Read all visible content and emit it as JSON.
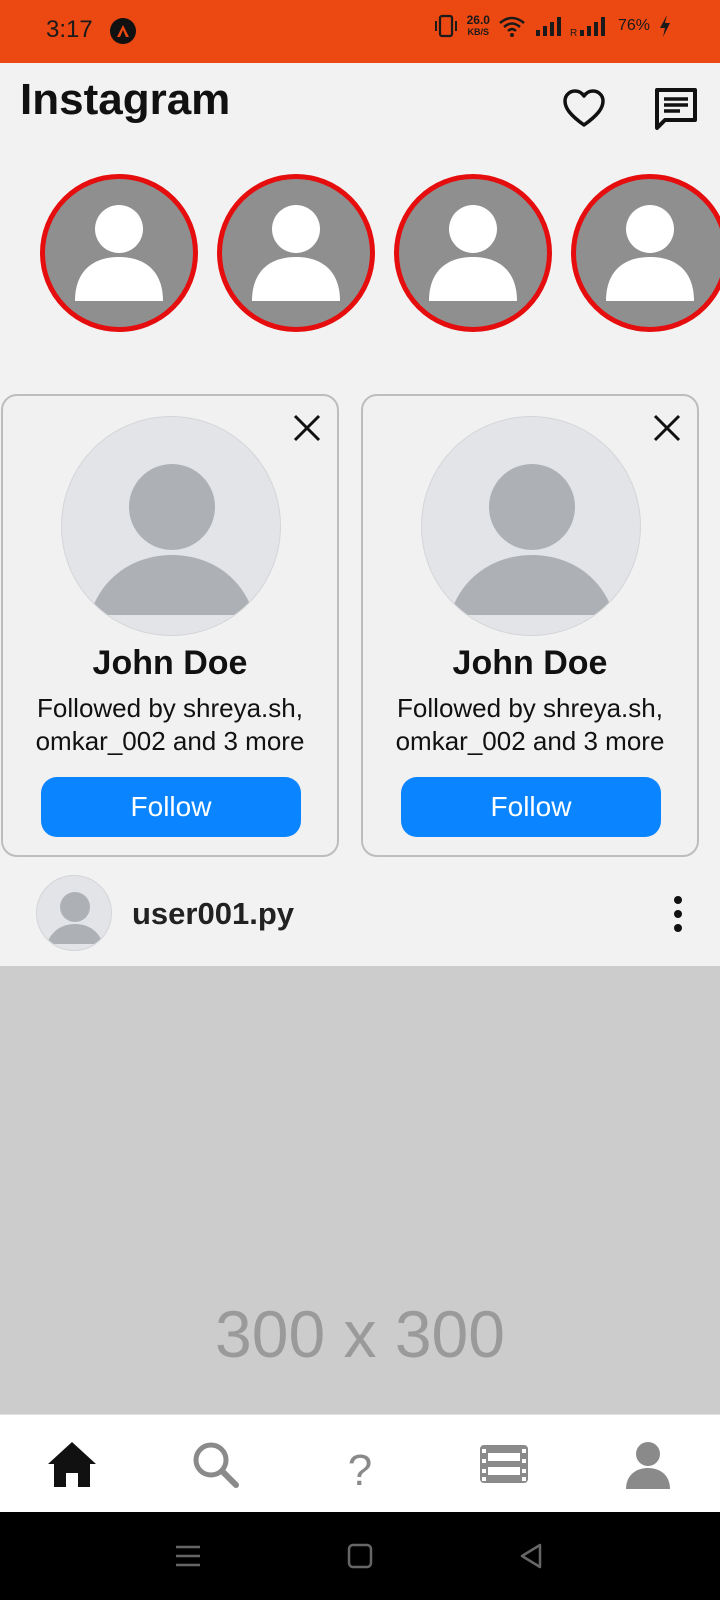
{
  "status_bar": {
    "time": "3:17",
    "speed_value": "26.0",
    "speed_unit": "KB/S",
    "battery": "76%"
  },
  "header": {
    "title": "Instagram"
  },
  "stories": {
    "count_visible": 4,
    "ring_color": "#e50d0d"
  },
  "suggestions": [
    {
      "name": "John Doe",
      "subtitle_line1": "Followed by shreya.sh,",
      "subtitle_line2": "omkar_002 and 3 more",
      "button_label": "Follow"
    },
    {
      "name": "John Doe",
      "subtitle_line1": "Followed by shreya.sh,",
      "subtitle_line2": "omkar_002 and 3 more",
      "button_label": "Follow"
    }
  ],
  "post": {
    "username": "user001.py",
    "image_placeholder": "300 x 300"
  },
  "bottom_nav": {
    "items": [
      "home-icon",
      "search-icon",
      "help-icon",
      "reels-icon",
      "profile-icon"
    ],
    "help_glyph": "?"
  },
  "colors": {
    "status_bar": "#eb4812",
    "accent": "#0a84ff",
    "story_ring": "#e50d0d"
  }
}
